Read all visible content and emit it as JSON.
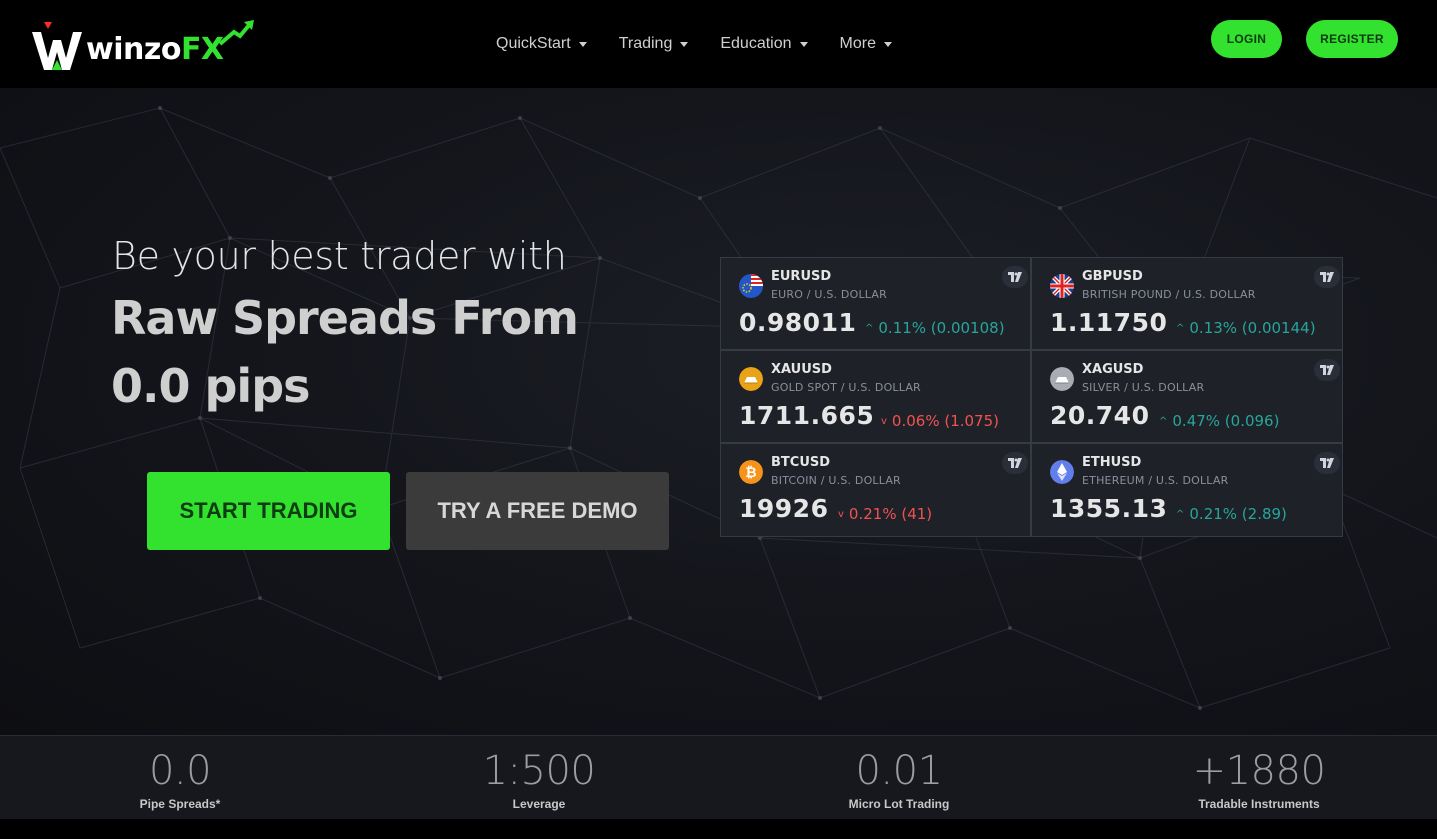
{
  "brand": {
    "name_main": "winzo",
    "name_accent": "FX",
    "accent_color": "#33e12f"
  },
  "nav": {
    "items": [
      {
        "label": "QuickStart"
      },
      {
        "label": "Trading"
      },
      {
        "label": "Education"
      },
      {
        "label": "More"
      }
    ],
    "login_label": "LOGIN",
    "register_label": "REGISTER"
  },
  "hero": {
    "tagline": "Be your best trader with",
    "headline": "Raw Spreads From 0.0 pips",
    "start_label": "START TRADING",
    "demo_label": "TRY A FREE DEMO"
  },
  "tickers": [
    {
      "symbol": "EURUSD",
      "description": "EURO / U.S. DOLLAR",
      "price": "0.98011",
      "change": "0.11% (0.00108)",
      "direction": "up",
      "icon": "eu-us-flag-icon"
    },
    {
      "symbol": "GBPUSD",
      "description": "BRITISH POUND / U.S. DOLLAR",
      "price": "1.11750",
      "change": "0.13% (0.00144)",
      "direction": "up",
      "icon": "uk-us-flag-icon"
    },
    {
      "symbol": "XAUUSD",
      "description": "GOLD SPOT / U.S. DOLLAR",
      "price": "1711.665",
      "change": "0.06% (1.075)",
      "direction": "down",
      "icon": "gold-icon"
    },
    {
      "symbol": "XAGUSD",
      "description": "SILVER / U.S. DOLLAR",
      "price": "20.740",
      "change": "0.47% (0.096)",
      "direction": "up",
      "icon": "silver-icon"
    },
    {
      "symbol": "BTCUSD",
      "description": "BITCOIN / U.S. DOLLAR",
      "price": "19926",
      "change": "0.21% (41)",
      "direction": "down",
      "icon": "bitcoin-icon"
    },
    {
      "symbol": "ETHUSD",
      "description": "ETHEREUM / U.S. DOLLAR",
      "price": "1355.13",
      "change": "0.21% (2.89)",
      "direction": "up",
      "icon": "ethereum-icon"
    }
  ],
  "stats": [
    {
      "value": "0.0",
      "label": "Pipe Spreads*"
    },
    {
      "value": "1:500",
      "label": "Leverage"
    },
    {
      "value": "0.01",
      "label": "Micro Lot Trading"
    },
    {
      "value": "+1880",
      "label": "Tradable Instruments"
    }
  ],
  "colors": {
    "up": "#26a69a",
    "down": "#ef5350",
    "button_green": "#33e12f"
  }
}
